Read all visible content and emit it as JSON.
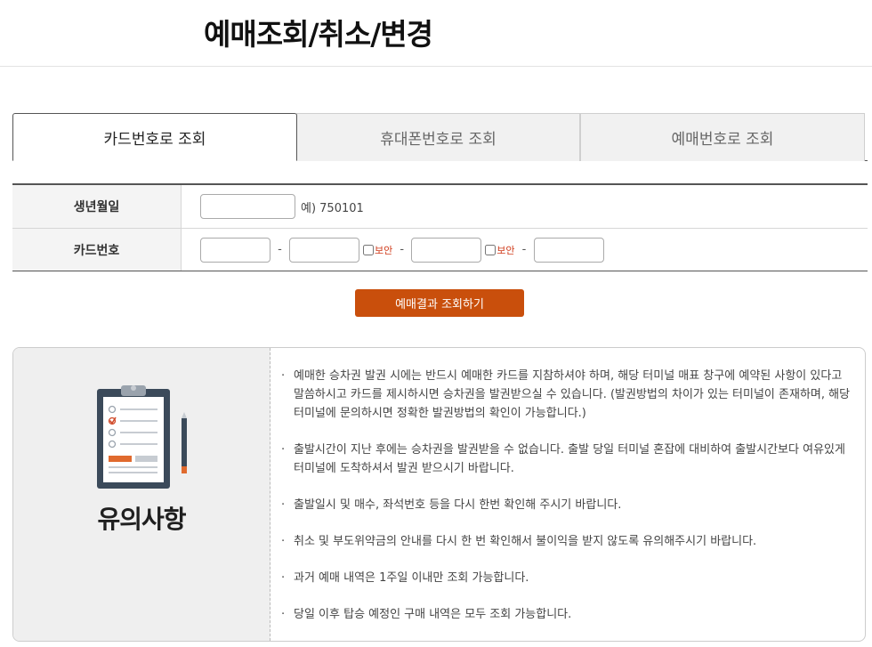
{
  "page": {
    "title": "예매조회/취소/변경"
  },
  "tabs": [
    {
      "label": "카드번호로 조회",
      "active": true
    },
    {
      "label": "휴대폰번호로 조회",
      "active": false
    },
    {
      "label": "예매번호로 조회",
      "active": false
    }
  ],
  "form": {
    "birth_label": "생년월일",
    "birth_value": "",
    "birth_hint": "예) 750101",
    "card_label": "카드번호",
    "card_values": [
      "",
      "",
      "",
      ""
    ],
    "separator": "-",
    "secure_label": "보안"
  },
  "search_button": "예매결과 조회하기",
  "notice": {
    "title": "유의사항",
    "icon": "clipboard-checklist-icon",
    "items": [
      "예매한 승차권 발권 시에는 반드시 예매한 카드를 지참하셔야 하며, 해당 터미널 매표 창구에 예약된 사항이 있다고 말씀하시고 카드를 제시하시면 승차권을 발권받으실 수 있습니다. (발권방법의 차이가 있는 터미널이 존재하며, 해당 터미널에 문의하시면 정확한 발권방법의 확인이 가능합니다.)",
      "출발시간이 지난 후에는 승차권을 발권받을 수 없습니다. 출발 당일 터미널 혼잡에 대비하여 출발시간보다 여유있게 터미널에 도착하셔서 발권 받으시기 바랍니다.",
      "출발일시 및 매수, 좌석번호 등을 다시 한번 확인해 주시기 바랍니다.",
      "취소 및 부도위약금의 안내를 다시 한 번 확인해서 불이익을 받지 않도록 유의해주시기 바랍니다.",
      "과거 예매 내역은 1주일 이내만 조회 가능합니다.",
      "당일 이후 탑승 예정인 구매 내역은 모두 조회 가능합니다."
    ]
  },
  "colors": {
    "accent": "#c94f0c",
    "secure_text": "#d03a1a"
  }
}
